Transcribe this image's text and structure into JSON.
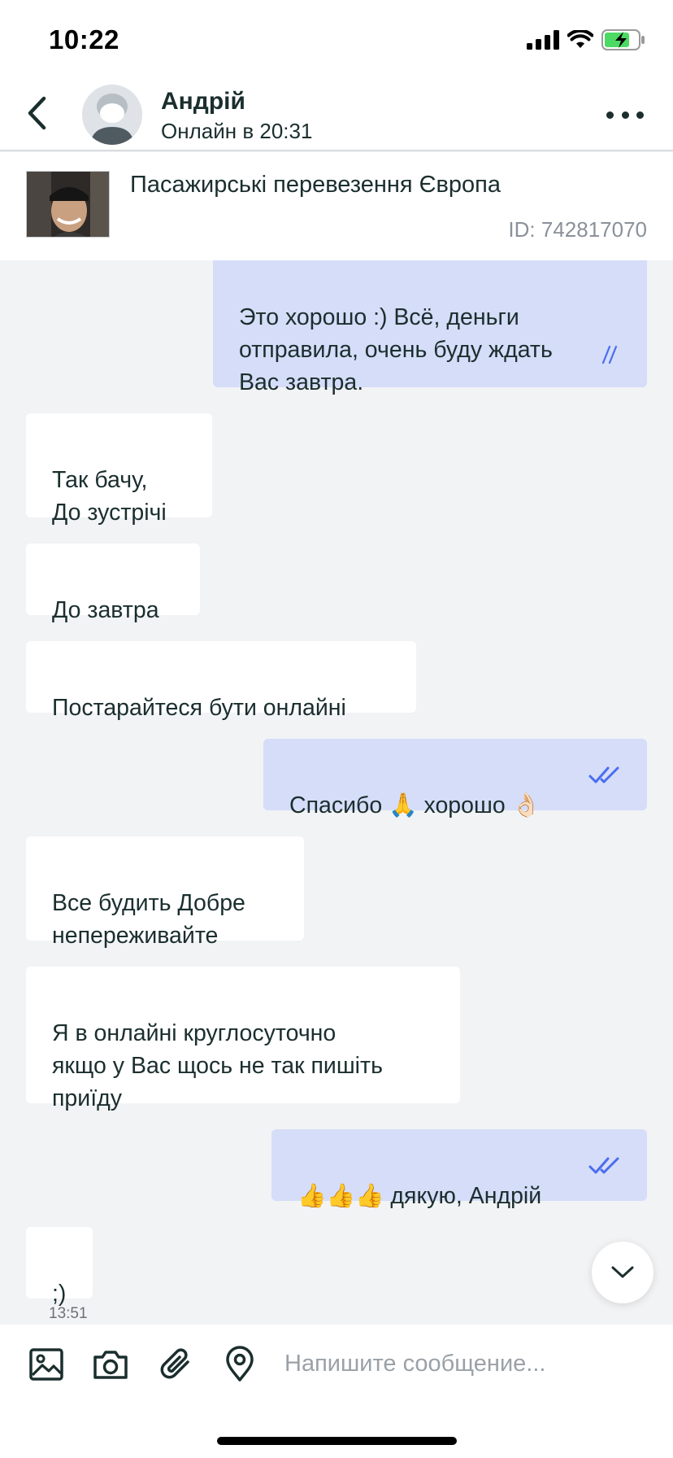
{
  "status_bar": {
    "time": "10:22"
  },
  "header": {
    "name": "Андрій",
    "status": "Онлайн в 20:31"
  },
  "listing": {
    "title": "Пасажирські перевезення Європа",
    "id_text": "ID: 742817070"
  },
  "messages": [
    {
      "direction": "out",
      "text": "Это хорошо :) Всё, деньги\nотправила, очень буду ждать\nВас завтра.",
      "read": true
    },
    {
      "direction": "in",
      "text": "Так бачу,\nДо зустрічі"
    },
    {
      "direction": "in",
      "text": "До завтра"
    },
    {
      "direction": "in",
      "text": "Постарайтеся бути онлайні"
    },
    {
      "direction": "out",
      "text": "Спасибо 🙏 хорошо 👌🏻",
      "read": true
    },
    {
      "direction": "in",
      "text": "Все будить Добре\nнепереживайте"
    },
    {
      "direction": "in",
      "text": "Я в онлайні круглосуточно\nякщо  у Вас щось не так пишіть\nприїду"
    },
    {
      "direction": "out",
      "text": "👍👍👍 дякую, Андрій",
      "read": true
    },
    {
      "direction": "in",
      "text": ";)",
      "time": "13:51"
    }
  ],
  "composer": {
    "placeholder": "Напишите сообщение..."
  },
  "icons": [
    "back-arrow-icon",
    "more-icon",
    "gallery-icon",
    "camera-icon",
    "paperclip-icon",
    "location-pin-icon",
    "chevron-down-icon",
    "double-check-icon"
  ],
  "colors": {
    "outgoing_bubble": "#d5ddf8",
    "incoming_bubble": "#ffffff",
    "chat_background": "#f2f3f5",
    "check_color": "#4a6cf0"
  }
}
